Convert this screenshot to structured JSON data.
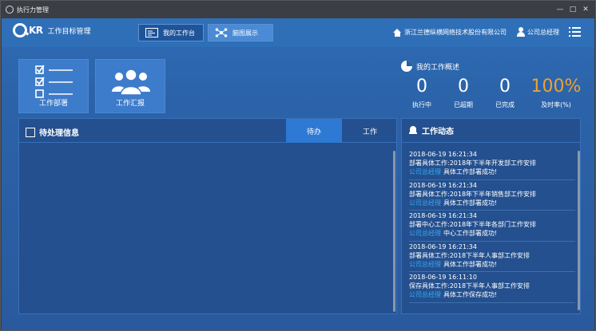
{
  "window": {
    "title": "执行力管理",
    "controls": [
      "minimize",
      "maximize",
      "close"
    ]
  },
  "header": {
    "logo_kr": "KR",
    "app_name": "工作目标管理",
    "tabs": [
      {
        "label": "我的工作台",
        "icon": "dashboard-icon",
        "active": true
      },
      {
        "label": "脑图展示",
        "icon": "mindmap-icon",
        "active": false
      }
    ],
    "company": "浙江兰德纵横网络技术股份有限公司",
    "user": "公司总经理"
  },
  "tiles": [
    {
      "label": "工作部署",
      "icon": "checklist-icon"
    },
    {
      "label": "工作汇报",
      "icon": "group-icon"
    }
  ],
  "overview": {
    "title": "我的工作概述",
    "stats": [
      {
        "value": "0",
        "label": "执行中"
      },
      {
        "value": "0",
        "label": "已超期"
      },
      {
        "value": "0",
        "label": "已完成"
      },
      {
        "value": "100%",
        "label": "及时率(%)"
      }
    ]
  },
  "pending": {
    "title": "待处理信息",
    "tabs": [
      {
        "label": "待办",
        "active": true
      },
      {
        "label": "工作",
        "active": false
      }
    ]
  },
  "activity": {
    "title": "工作动态",
    "items": [
      {
        "time": "2018-06-19 16:21:34",
        "text": "部署具体工作:2018年下半年开发部工作安排",
        "who": "公司总经理",
        "result": "具体工作部署成功!"
      },
      {
        "time": "2018-06-19 16:21:34",
        "text": "部署具体工作:2018年下半年销售部工作安排",
        "who": "公司总经理",
        "result": "具体工作部署成功!"
      },
      {
        "time": "2018-06-19 16:21:34",
        "text": "部署中心工作:2018年下半年各部门工作安排",
        "who": "公司总经理",
        "result": "中心工作部署成功!"
      },
      {
        "time": "2018-06-19 16:21:34",
        "text": "部署具体工作:2018下半年人事部工作安排",
        "who": "公司总经理",
        "result": "具体工作部署成功!"
      },
      {
        "time": "2018-06-19 16:11:10",
        "text": "保存具体工作:2018下半年人事部工作安排",
        "who": "公司总经理",
        "result": "具体工作保存成功!"
      }
    ]
  },
  "colors": {
    "accent": "#f0a030",
    "link": "#35a8f0",
    "panel": "#24508f",
    "topbar": "#2f6fb8"
  }
}
